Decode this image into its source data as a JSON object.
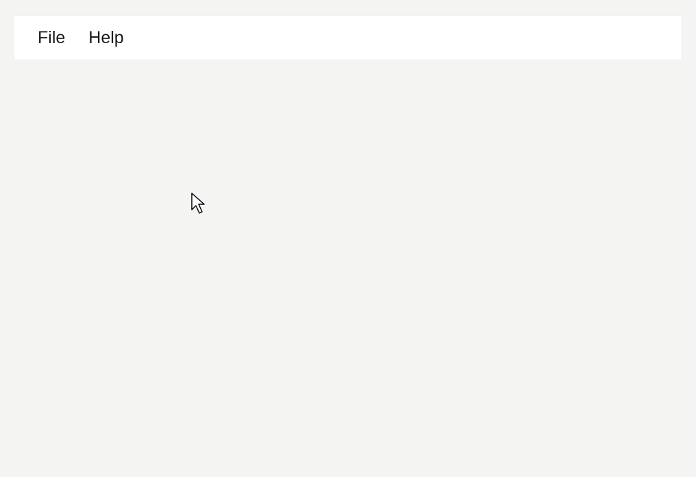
{
  "menubar": {
    "items": [
      {
        "label": "File"
      },
      {
        "label": "Help"
      }
    ]
  }
}
